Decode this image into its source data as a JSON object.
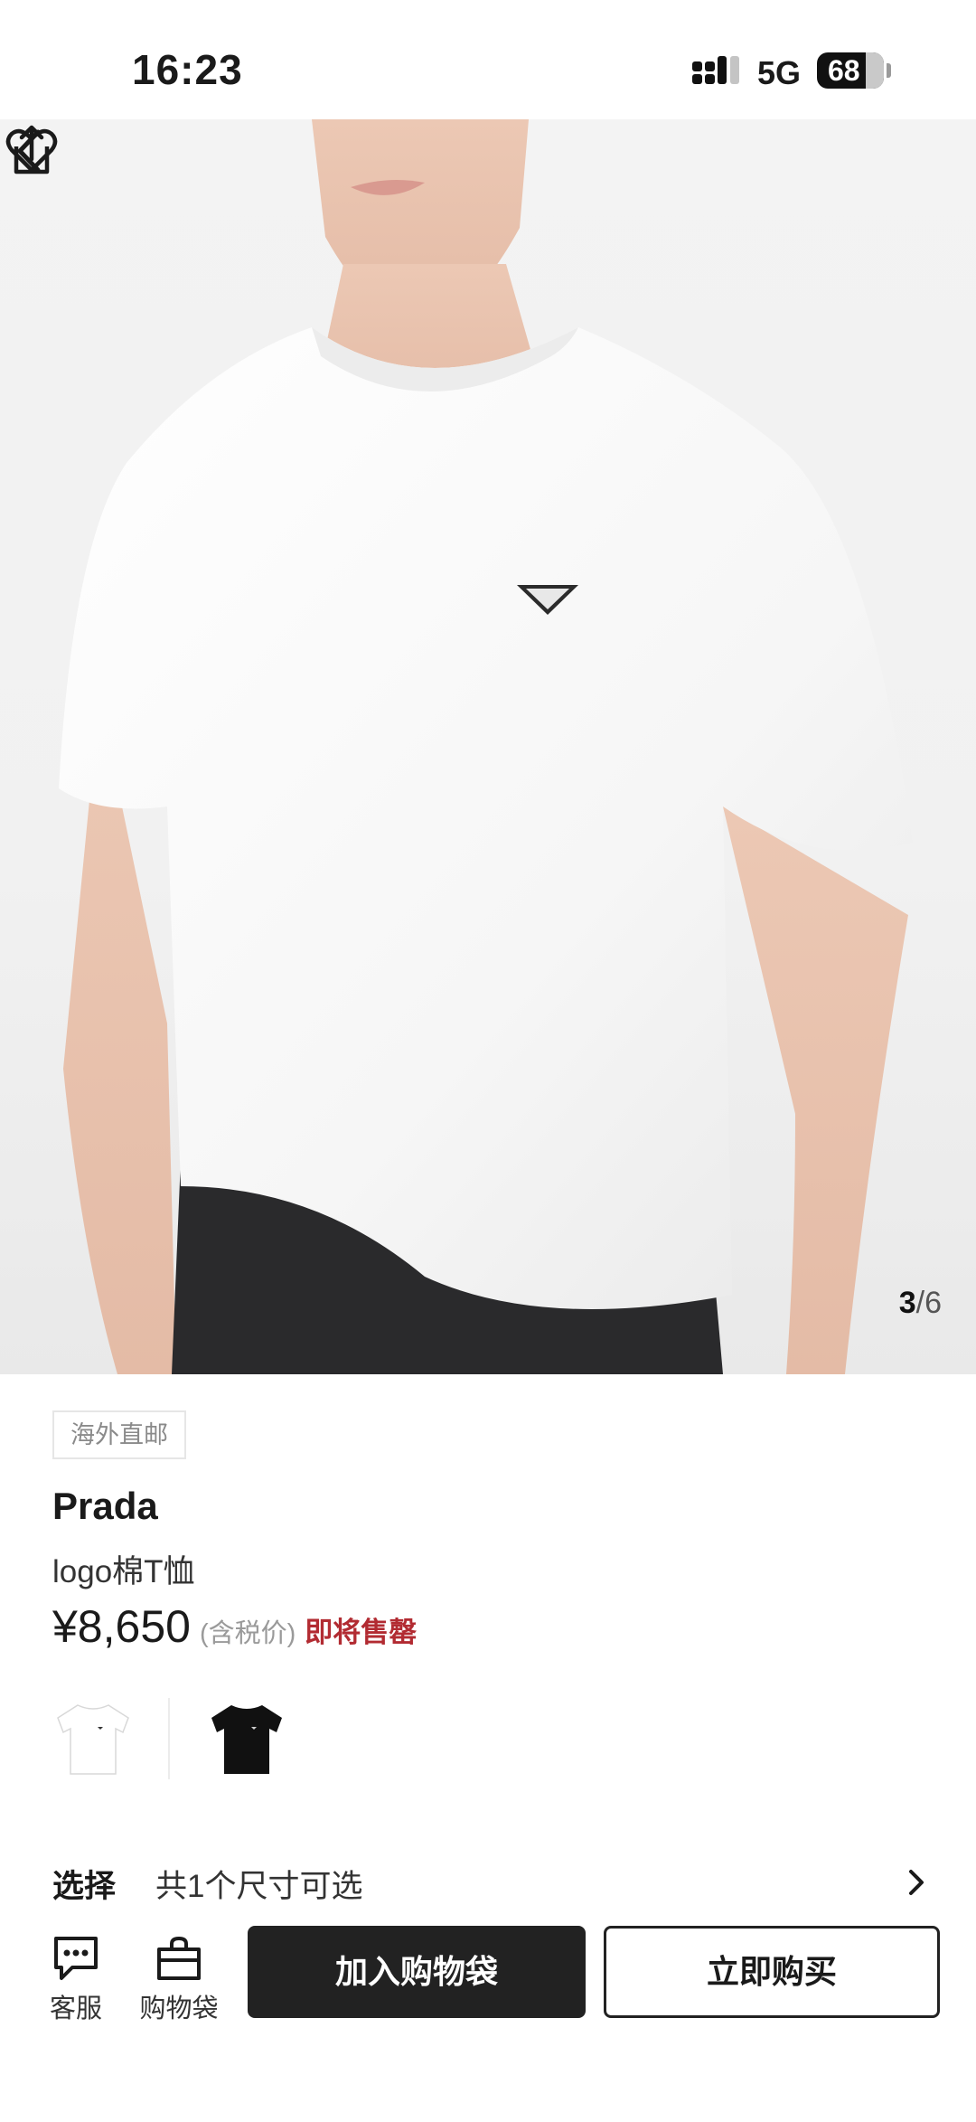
{
  "status_bar": {
    "time": "16:23",
    "network": "5G",
    "battery": "68"
  },
  "gallery": {
    "current": "3",
    "separator": "/",
    "total": "6",
    "icons": [
      "back-icon",
      "share-icon",
      "heart-icon"
    ]
  },
  "product": {
    "tag": "海外直邮",
    "brand": "Prada",
    "name": "logo棉T恤",
    "price": "¥8,650",
    "tax_note": "(含税价)",
    "stock_note": "即将售罄",
    "swatches": [
      {
        "color": "#ffffff"
      },
      {
        "color": "#111111"
      }
    ]
  },
  "size_select": {
    "label": "选择",
    "value": "共1个尺寸可选"
  },
  "bottom_bar": {
    "service_label": "客服",
    "bag_label": "购物袋",
    "add_to_bag": "加入购物袋",
    "buy_now": "立即购买"
  },
  "colors": {
    "accent_red": "#b22b32",
    "primary_button": "#222222"
  }
}
